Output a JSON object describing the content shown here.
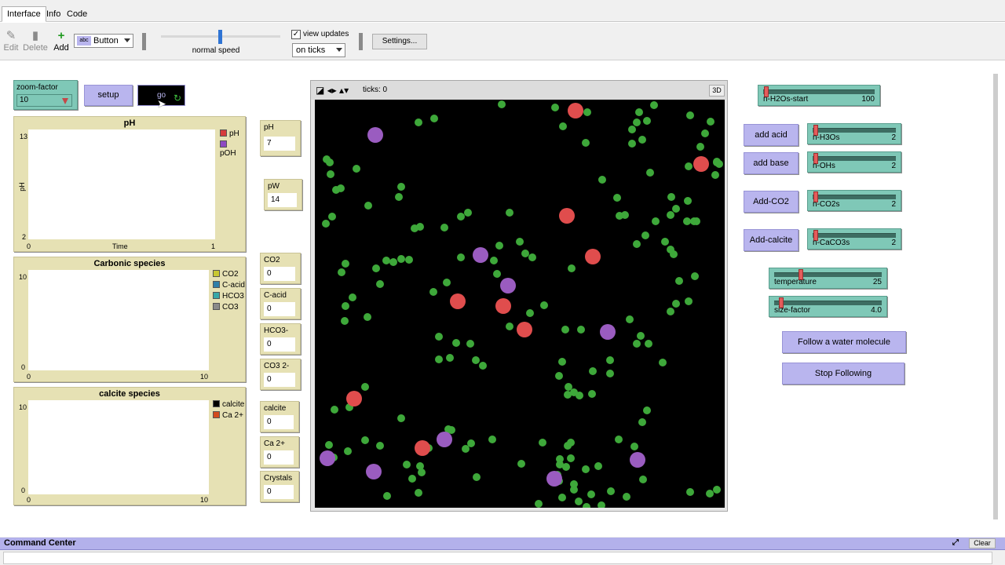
{
  "tabs": [
    "Interface",
    "Info",
    "Code"
  ],
  "toolbar": {
    "edit": "Edit",
    "delete": "Delete",
    "add": "Add",
    "widget_type": "Button",
    "speed_label": "normal speed",
    "view_updates_label": "view updates",
    "view_updates_checked": true,
    "update_mode": "on ticks",
    "settings": "Settings..."
  },
  "chooser": {
    "label": "zoom-factor",
    "value": "10"
  },
  "buttons": {
    "setup": "setup",
    "go": "go",
    "add_acid": "add acid",
    "add_base": "add base",
    "add_co2": "Add-CO2",
    "add_calcite": "Add-calcite",
    "follow": "Follow a water molecule",
    "stop_follow": "Stop Following"
  },
  "plots": {
    "ph": {
      "title": "pH",
      "ymax": "13",
      "ymin": "2",
      "xmin": "0",
      "xmax": "1",
      "xlabel": "Time",
      "ylabel": "pH",
      "legend": [
        {
          "name": "pH",
          "color": "#d63c3c"
        },
        {
          "name": "pOH",
          "color": "#8e4bc2"
        }
      ]
    },
    "carbonic": {
      "title": "Carbonic species",
      "ymax": "10",
      "ymin": "0",
      "xmin": "0",
      "xmax": "10",
      "legend": [
        {
          "name": "CO2",
          "color": "#c8c832"
        },
        {
          "name": "C-acid",
          "color": "#2f7fa8"
        },
        {
          "name": "HCO3",
          "color": "#38a8a8"
        },
        {
          "name": "CO3",
          "color": "#8a8a8a"
        }
      ]
    },
    "calcite": {
      "title": "calcite species",
      "ymax": "10",
      "ymin": "0",
      "xmin": "0",
      "xmax": "10",
      "legend": [
        {
          "name": "calcite",
          "color": "#000000"
        },
        {
          "name": "Ca 2+",
          "color": "#d24a1e"
        }
      ]
    }
  },
  "monitors": {
    "ph": {
      "label": "pH",
      "value": "7"
    },
    "pw": {
      "label": "pW",
      "value": "14"
    },
    "co2": {
      "label": "CO2",
      "value": "0"
    },
    "cacid": {
      "label": "C-acid",
      "value": "0"
    },
    "hco3": {
      "label": "HCO3-",
      "value": "0"
    },
    "co3": {
      "label": "CO3 2-",
      "value": "0"
    },
    "calcite": {
      "label": "calcite",
      "value": "0"
    },
    "ca2": {
      "label": "Ca 2+",
      "value": "0"
    },
    "crystals": {
      "label": "Crystals",
      "value": "0"
    }
  },
  "view": {
    "ticks": "ticks: 0",
    "btn3d": "3D"
  },
  "sliders": {
    "h2o": {
      "label": "n-H2Os-start",
      "value": "100"
    },
    "h3o": {
      "label": "n-H3Os",
      "value": "2"
    },
    "oh": {
      "label": "n-OHs",
      "value": "2"
    },
    "co2s": {
      "label": "n-CO2s",
      "value": "2"
    },
    "caco3": {
      "label": "n-CaCO3s",
      "value": "2"
    },
    "temp": {
      "label": "temperature",
      "value": "25"
    },
    "size": {
      "label": "size-factor",
      "value": "4.0"
    }
  },
  "command_center": {
    "title": "Command Center",
    "clear": "Clear"
  },
  "colors": {
    "water": "#3ea83a",
    "acid": "#e04d4d",
    "base": "#9a5cc0",
    "slider": "#7fc8b7",
    "button": "#b9b5ee",
    "plot": "#e6e1b4"
  },
  "world": {
    "water": [
      [
        238,
        6
      ],
      [
        152,
        24
      ],
      [
        110,
        111
      ],
      [
        132,
        29
      ],
      [
        53,
        88
      ],
      [
        19,
        80
      ],
      [
        15,
        76
      ],
      [
        20,
        95
      ],
      [
        27,
        115
      ],
      [
        33,
        113
      ],
      [
        68,
        135
      ],
      [
        107,
        124
      ],
      [
        100,
        207
      ],
      [
        120,
        204
      ],
      [
        127,
        164
      ],
      [
        91,
        205
      ],
      [
        83,
        235
      ],
      [
        48,
        252
      ],
      [
        38,
        282
      ],
      [
        67,
        277
      ],
      [
        151,
        245
      ],
      [
        168,
        233
      ],
      [
        158,
        302
      ],
      [
        180,
        310
      ],
      [
        158,
        331
      ],
      [
        172,
        329
      ],
      [
        214,
        339
      ],
      [
        248,
        289
      ],
      [
        274,
        272
      ],
      [
        261,
        181
      ],
      [
        268,
        196
      ],
      [
        277,
        201
      ],
      [
        327,
        215
      ],
      [
        319,
        293
      ],
      [
        339,
        293
      ],
      [
        323,
        366
      ],
      [
        292,
        262
      ],
      [
        337,
        377
      ],
      [
        353,
        375
      ],
      [
        311,
        352
      ],
      [
        322,
        376
      ],
      [
        315,
        334
      ],
      [
        354,
        346
      ],
      [
        311,
        486
      ],
      [
        263,
        464
      ],
      [
        290,
        437
      ],
      [
        326,
        437
      ],
      [
        309,
        478
      ],
      [
        346,
        519
      ],
      [
        285,
        515
      ],
      [
        322,
        441
      ],
      [
        312,
        458
      ],
      [
        312,
        465
      ],
      [
        326,
        457
      ],
      [
        330,
        373
      ],
      [
        345,
        471
      ],
      [
        352,
        503
      ],
      [
        361,
        467
      ],
      [
        377,
        499
      ],
      [
        401,
        280
      ],
      [
        410,
        311
      ],
      [
        415,
        301
      ],
      [
        425,
        311
      ],
      [
        423,
        396
      ],
      [
        443,
        335
      ],
      [
        453,
        270
      ],
      [
        460,
        260
      ],
      [
        464,
        231
      ],
      [
        457,
        197
      ],
      [
        453,
        191
      ],
      [
        484,
        225
      ],
      [
        476,
        257
      ],
      [
        474,
        155
      ],
      [
        483,
        155
      ],
      [
        460,
        139
      ],
      [
        446,
        181
      ],
      [
        476,
        85
      ],
      [
        486,
        155
      ],
      [
        410,
        184
      ],
      [
        421,
        173
      ],
      [
        434,
        155
      ],
      [
        453,
        147
      ],
      [
        475,
        129
      ],
      [
        491,
        60
      ],
      [
        510,
        96
      ],
      [
        515,
        82
      ],
      [
        512,
        79
      ],
      [
        512,
        80
      ],
      [
        504,
        28
      ],
      [
        413,
        16
      ],
      [
        410,
        29
      ],
      [
        417,
        51
      ],
      [
        404,
        56
      ],
      [
        432,
        7
      ],
      [
        404,
        38
      ],
      [
        306,
        10
      ],
      [
        316,
        34
      ],
      [
        345,
        55
      ],
      [
        366,
        102
      ],
      [
        388,
        148
      ],
      [
        395,
        147
      ],
      [
        427,
        93
      ],
      [
        385,
        125
      ],
      [
        347,
        16
      ],
      [
        423,
        27
      ],
      [
        454,
        124
      ],
      [
        497,
        43
      ],
      [
        478,
        20
      ],
      [
        512,
        497
      ],
      [
        503,
        502
      ],
      [
        365,
        517
      ],
      [
        397,
        506
      ],
      [
        478,
        500
      ],
      [
        387,
        433
      ],
      [
        407,
        442
      ],
      [
        418,
        484
      ],
      [
        417,
        411
      ],
      [
        376,
        332
      ],
      [
        376,
        349
      ],
      [
        315,
        507
      ],
      [
        336,
        512
      ],
      [
        330,
        497
      ],
      [
        320,
        468
      ],
      [
        330,
        490
      ],
      [
        199,
        438
      ],
      [
        174,
        421
      ],
      [
        206,
        481
      ],
      [
        124,
        483
      ],
      [
        134,
        467
      ],
      [
        83,
        441
      ],
      [
        92,
        505
      ],
      [
        132,
        501
      ],
      [
        136,
        475
      ],
      [
        110,
        406
      ],
      [
        64,
        366
      ],
      [
        42,
        448
      ],
      [
        64,
        434
      ],
      [
        25,
        395
      ],
      [
        17,
        461
      ],
      [
        24,
        456
      ],
      [
        18,
        440
      ],
      [
        44,
        392
      ],
      [
        39,
        263
      ],
      [
        34,
        220
      ],
      [
        39,
        209
      ],
      [
        22,
        149
      ],
      [
        14,
        158
      ],
      [
        78,
        215
      ],
      [
        110,
        203
      ],
      [
        134,
        162
      ],
      [
        165,
        163
      ],
      [
        228,
        205
      ],
      [
        186,
        201
      ],
      [
        186,
        149
      ],
      [
        195,
        144
      ],
      [
        248,
        144
      ],
      [
        235,
        186
      ],
      [
        232,
        222
      ],
      [
        205,
        332
      ],
      [
        198,
        311
      ],
      [
        117,
        465
      ],
      [
        145,
        444
      ],
      [
        170,
        420
      ],
      [
        192,
        445
      ],
      [
        226,
        433
      ]
    ],
    "acid": [
      [
        332,
        14
      ],
      [
        492,
        82
      ],
      [
        321,
        148
      ],
      [
        354,
        200
      ],
      [
        182,
        257
      ],
      [
        240,
        263
      ],
      [
        267,
        293
      ],
      [
        50,
        381
      ],
      [
        137,
        444
      ]
    ],
    "base": [
      [
        77,
        45
      ],
      [
        211,
        198
      ],
      [
        246,
        237
      ],
      [
        373,
        296
      ],
      [
        165,
        433
      ],
      [
        16,
        457
      ],
      [
        75,
        474
      ],
      [
        305,
        483
      ],
      [
        411,
        459
      ]
    ]
  }
}
